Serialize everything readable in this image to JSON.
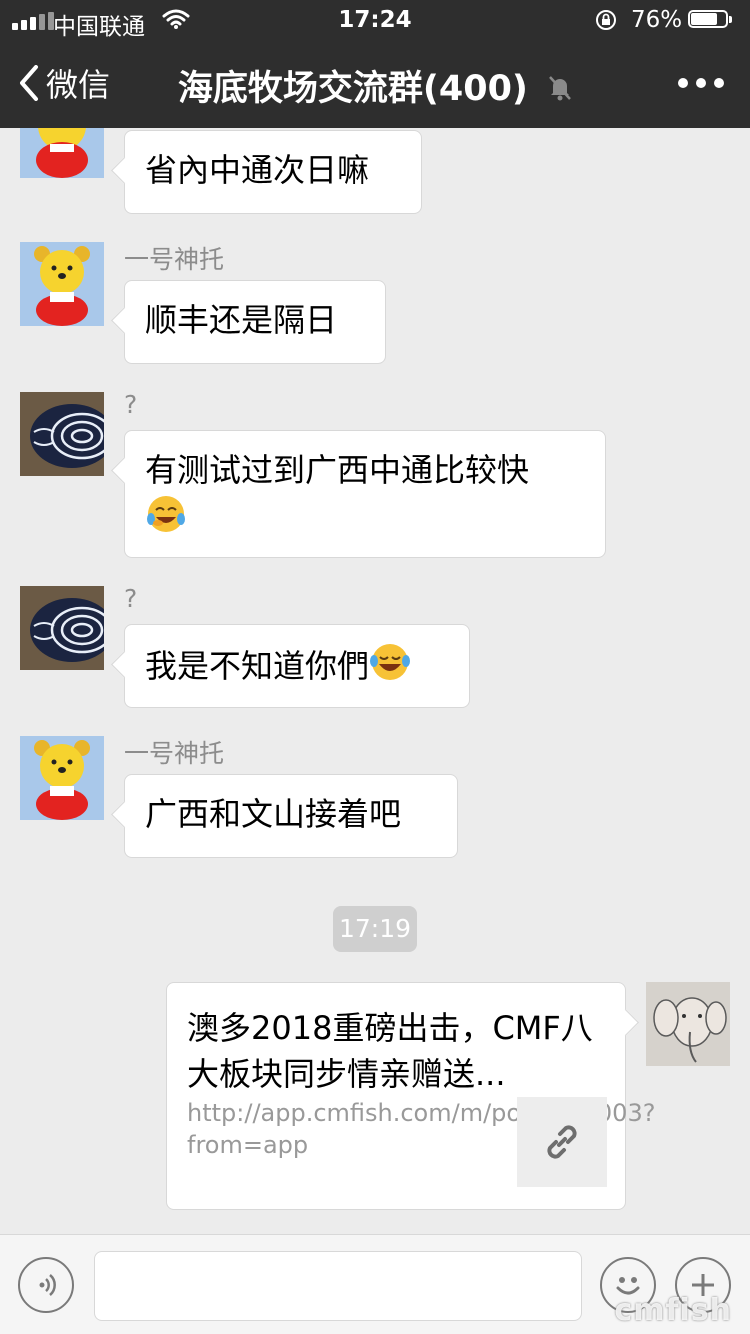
{
  "status_bar": {
    "carrier": "中国联通",
    "time": "17:24",
    "battery_percent": "76%",
    "battery_level": 0.76
  },
  "nav": {
    "back_label": "微信",
    "title": "海底牧场交流群(400)",
    "icons": [
      "chevron-left-icon",
      "mute-bell-icon",
      "more-icon"
    ]
  },
  "messages": [
    {
      "sender": "",
      "text": "省內中通次日嘛",
      "emoji": null
    },
    {
      "sender": "一号神托",
      "text": "顺丰还是隔日",
      "emoji": null
    },
    {
      "sender": "?",
      "text": "有测试过到广西中通比较快",
      "emoji": "crying-laughing-emoji"
    },
    {
      "sender": "?",
      "text": "我是不知道你們",
      "emoji": "tears-of-joy-emoji"
    },
    {
      "sender": "一号神托",
      "text": "广西和文山接着吧",
      "emoji": null
    }
  ],
  "timestamp": "17:19",
  "link_card": {
    "title": "澳多2018重磅出击，CMF八大板块同步情亲赠送...",
    "url": "http://app.cmfish.com/m/post/610003?from=app",
    "thumb_icon": "link-icon"
  },
  "input_bar": {
    "icons": [
      "voice-icon",
      "emoji-face-icon",
      "plus-icon"
    ],
    "watermark": "cmfish"
  },
  "colors": {
    "header_bg": "#2e2e2e",
    "chat_bg": "#ececec",
    "bubble_bg": "#ffffff",
    "time_pill": "#cfcfcf"
  }
}
